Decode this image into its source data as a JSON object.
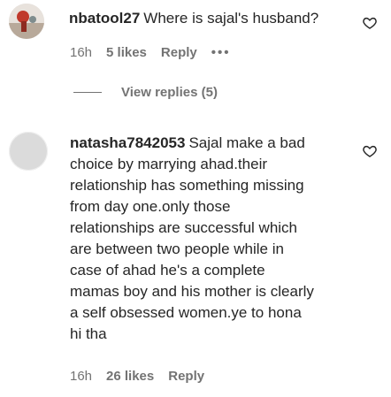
{
  "comments": [
    {
      "username": "nbatool27",
      "text": "Where is sajal's husband?",
      "time": "16h",
      "likes": "5 likes",
      "reply": "Reply",
      "more": "•••",
      "view_replies": "View replies (5)"
    },
    {
      "username": "natasha7842053",
      "text_lines": [
        "Sajal make a bad",
        "choice by marrying ahad.their",
        "relationship has something missing",
        "from day one.only those",
        "relationships are successful which",
        "are between two people while in",
        "case of ahad he's a complete",
        "mamas boy and his mother is clearly",
        "a self obsessed women.ye to hona",
        "hi tha"
      ],
      "time": "16h",
      "likes": "26 likes",
      "reply": "Reply"
    }
  ],
  "icons": {
    "heart": "heart-outline-icon",
    "avatar1": "user-avatar",
    "avatar2": "default-avatar"
  },
  "colors": {
    "text": "#262626",
    "muted": "#737373",
    "avatar_placeholder": "#dbdbdb",
    "avatar1_accent": "#c0392b"
  }
}
